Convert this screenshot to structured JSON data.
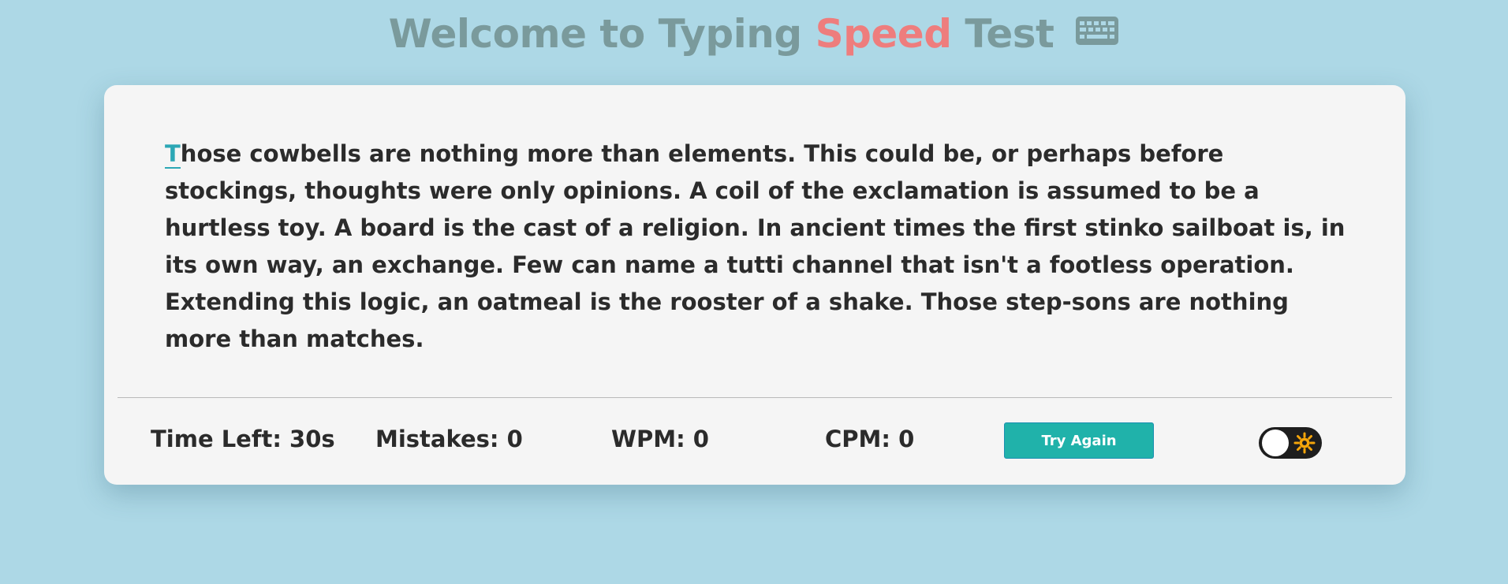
{
  "header": {
    "title_part1": "Welcome to Typing ",
    "title_accent": "Speed",
    "title_part2": " Test",
    "icon": "keyboard-icon",
    "accent_color": "#ee7d7d"
  },
  "passage": {
    "current_char": "T",
    "rest_text": "hose cowbells are nothing more than elements. This could be, or perhaps before stockings, thoughts were only opinions. A coil of the exclamation is assumed to be a hurtless toy. A board is the cast of a religion. In ancient times the first stinko sailboat is, in its own way, an exchange. Few can name a tutti channel that isn't a footless operation. Extending this logic, an oatmeal is the rooster of a shake. Those step-sons are nothing more than matches."
  },
  "stats": {
    "time_left": "Time Left: 30s",
    "mistakes": "Mistakes: 0",
    "wpm": "WPM: 0",
    "cpm": "CPM: 0"
  },
  "controls": {
    "try_again_label": "Try Again",
    "try_again_color": "#20b2aa",
    "theme_toggle_icon": "sun-icon",
    "theme_toggle_on": false
  },
  "colors": {
    "background": "#add8e6",
    "card": "#f5f5f5",
    "title": "#7a9a9c",
    "cursor": "#2ca7b5"
  }
}
